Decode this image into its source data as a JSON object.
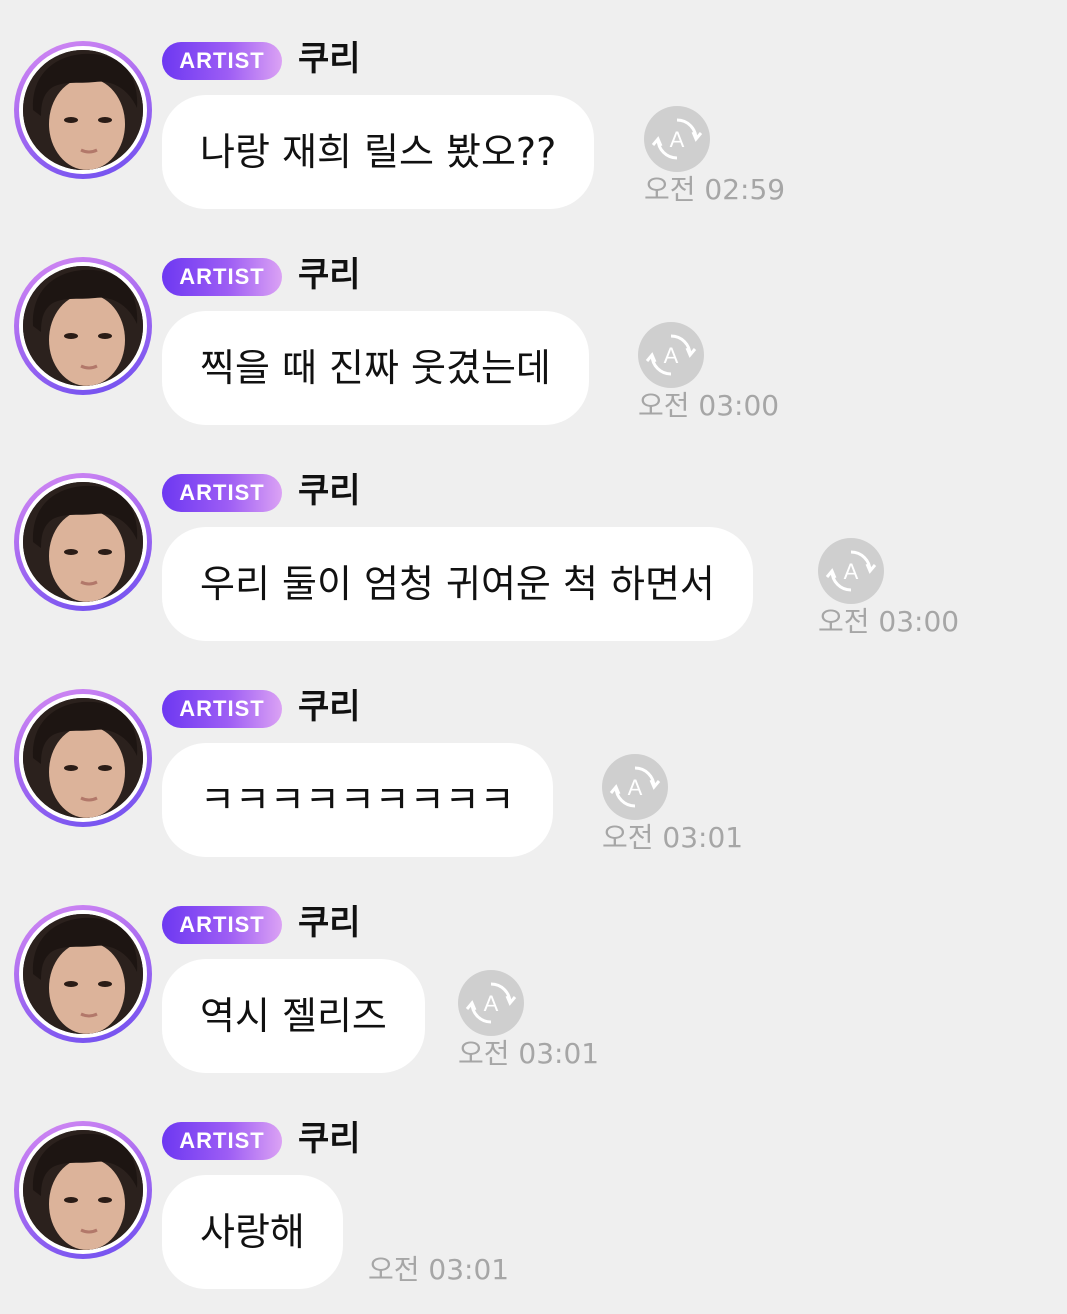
{
  "messages": [
    {
      "badge": "ARTIST",
      "sender": "쿠리",
      "text": "나랑 재희 릴스 봤오??",
      "time": "오전 02:59",
      "translate": true
    },
    {
      "badge": "ARTIST",
      "sender": "쿠리",
      "text": "찍을 때 진짜 웃겼는데",
      "time": "오전 03:00",
      "translate": true
    },
    {
      "badge": "ARTIST",
      "sender": "쿠리",
      "text": "우리 둘이 엄청 귀여운 척 하면서",
      "time": "오전 03:00",
      "translate": true
    },
    {
      "badge": "ARTIST",
      "sender": "쿠리",
      "text": "ㅋㅋㅋㅋㅋㅋㅋㅋㅋ",
      "time": "오전 03:01",
      "translate": true
    },
    {
      "badge": "ARTIST",
      "sender": "쿠리",
      "text": "역시 젤리즈",
      "time": "오전 03:01",
      "translate": true
    },
    {
      "badge": "ARTIST",
      "sender": "쿠리",
      "text": "사랑해",
      "time": "오전 03:01",
      "translate": false
    }
  ],
  "colors": {
    "background": "#efefef",
    "bubble": "#ffffff",
    "badge_start": "#6d38f2",
    "badge_end": "#dba2f4",
    "timestamp": "#a6a6a6",
    "translate_icon_bg": "#cfcfcf"
  },
  "icons": {
    "avatar": "profile-photo",
    "translate": "auto-translate-icon"
  }
}
